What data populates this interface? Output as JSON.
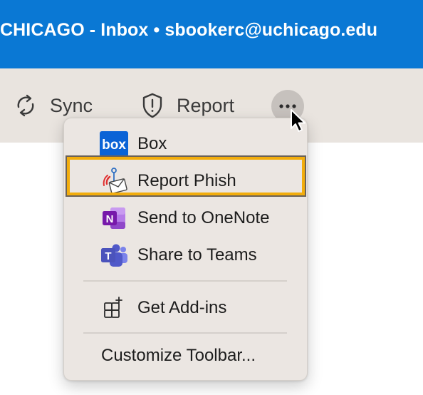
{
  "window": {
    "title": "CHICAGO - Inbox • sbookerc@uchicago.edu"
  },
  "toolbar": {
    "sync_label": "Sync",
    "report_label": "Report",
    "more_icon": "ellipsis-icon"
  },
  "menu": {
    "items": [
      {
        "label": "Box",
        "icon": "box-icon"
      },
      {
        "label": "Report Phish",
        "icon": "report-phish-icon"
      },
      {
        "label": "Send to OneNote",
        "icon": "onenote-icon"
      },
      {
        "label": "Share to Teams",
        "icon": "teams-icon"
      },
      {
        "label": "Get Add-ins",
        "icon": "add-ins-icon"
      }
    ],
    "customize_label": "Customize Toolbar...",
    "box_logo_text": "box"
  },
  "colors": {
    "titlebar": "#0a78d4",
    "toolbar": "#e9e4df",
    "highlight": "#f2ad0d"
  }
}
